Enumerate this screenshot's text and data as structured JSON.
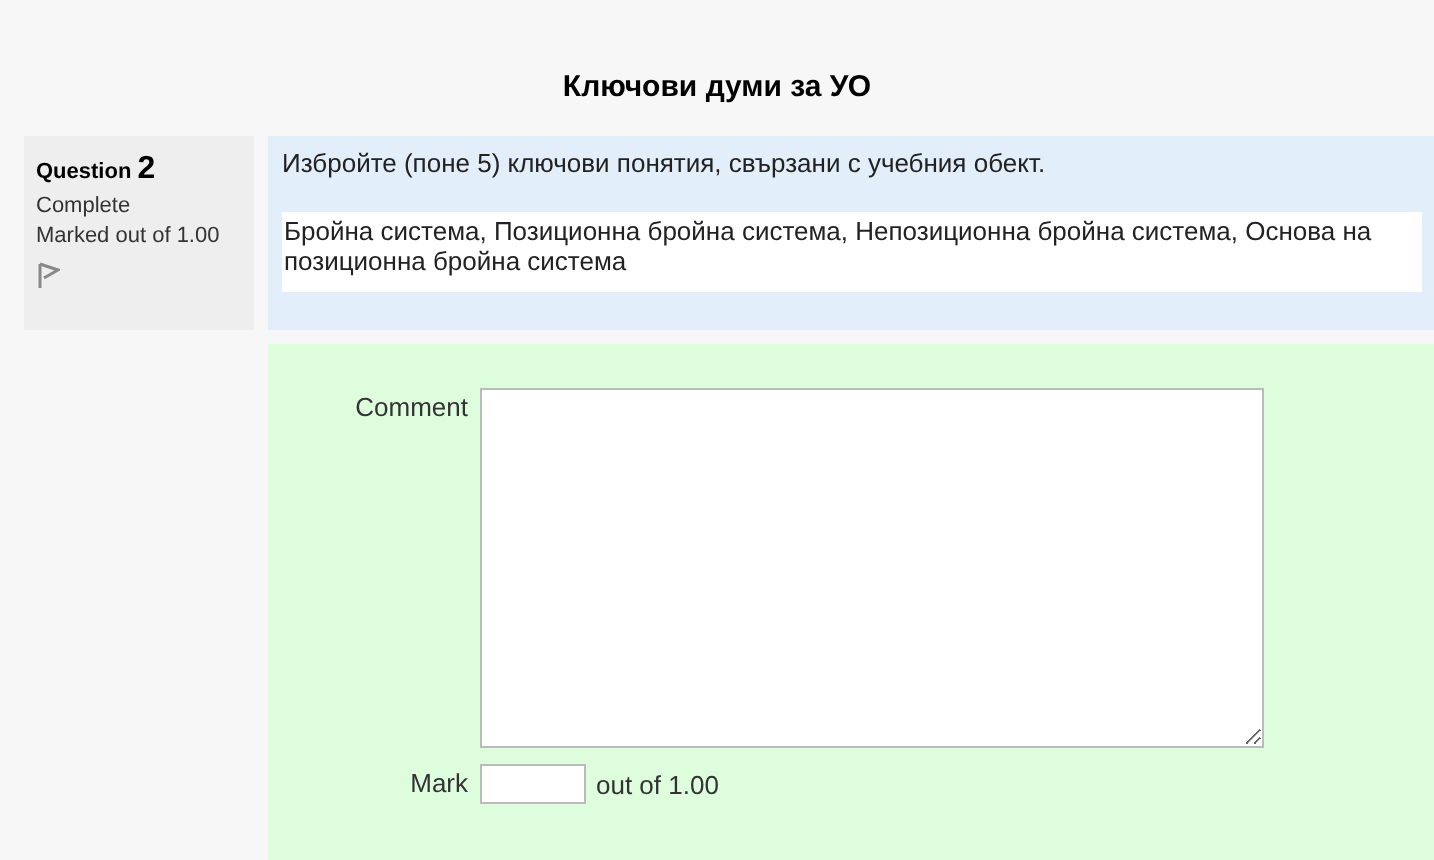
{
  "title": "Ключови думи за УО",
  "question": {
    "label": "Question",
    "number": "2",
    "state": "Complete",
    "grade": "Marked out of 1.00",
    "flagged": false
  },
  "prompt": "Избройте (поне 5) ключови понятия, свързани с учебния обект.",
  "answer": "Бройна система, Позиционна бройна система, Непозиционна бройна система, Основа на позиционна бройна система",
  "comment": {
    "label": "Comment"
  },
  "mark": {
    "label": "Mark",
    "suffix": "out of 1.00"
  }
}
